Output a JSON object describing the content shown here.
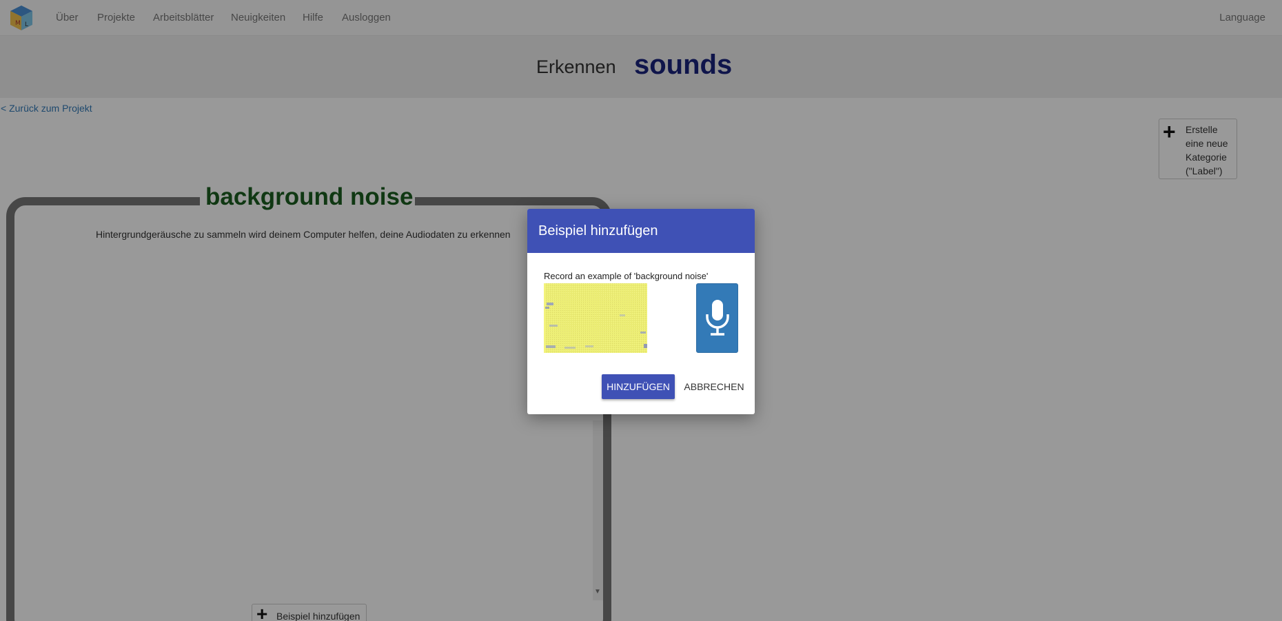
{
  "navbar": {
    "items": [
      "Über",
      "Projekte",
      "Arbeitsblätter",
      "Neuigkeiten",
      "Hilfe",
      "Ausloggen"
    ],
    "language": "Language"
  },
  "header": {
    "verb": "Erkennen",
    "project": "sounds"
  },
  "back_link": "< Zurück zum Projekt",
  "new_label_button": "Erstelle eine neue Kategorie (\"Label\")",
  "label_card": {
    "title": "background noise",
    "description": "Hintergrundgeräusche zu sammeln wird deinem Computer helfen, deine Audiodaten zu erkennen",
    "add_example": "Beispiel hinzufügen"
  },
  "dialog": {
    "title": "Beispiel hinzufügen",
    "instruction": "Record an example of 'background noise'",
    "add_button": "HINZUFÜGEN",
    "cancel_button": "ABBRECHEN",
    "mic_icon": "microphone-icon"
  },
  "colors": {
    "dialog_header": "#3f51b5",
    "mic_button": "#337ab7",
    "label_title": "#1b5e20",
    "project_title": "#1a237e"
  }
}
